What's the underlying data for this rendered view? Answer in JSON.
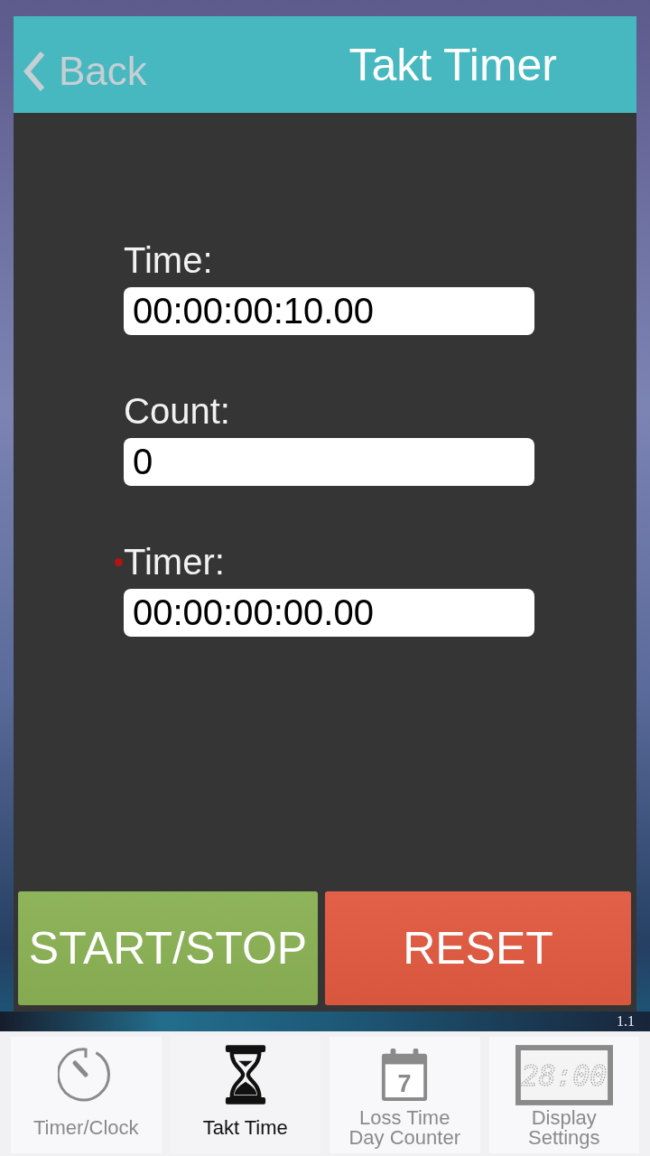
{
  "header": {
    "back": "Back",
    "title": "Takt Timer"
  },
  "fields": [
    {
      "label": "Time:",
      "value": "00:00:00:10.00",
      "marked": false
    },
    {
      "label": "Count:",
      "value": "0",
      "marked": false
    },
    {
      "label": "Timer:",
      "value": "00:00:00:00.00",
      "marked": true
    }
  ],
  "buttons": [
    {
      "label": "START/STOP",
      "color": "#8ab155"
    },
    {
      "label": "RESET",
      "color": "#e05a40"
    }
  ],
  "version": "1.1",
  "tabs": [
    {
      "label": "Timer/Clock",
      "selected": false
    },
    {
      "label": "Takt Time",
      "selected": true
    },
    {
      "label": "Loss Time\nDay Counter",
      "selected": false,
      "icon_text": "7"
    },
    {
      "label": "Display\nSettings",
      "selected": false,
      "icon_text": "28:00"
    }
  ]
}
